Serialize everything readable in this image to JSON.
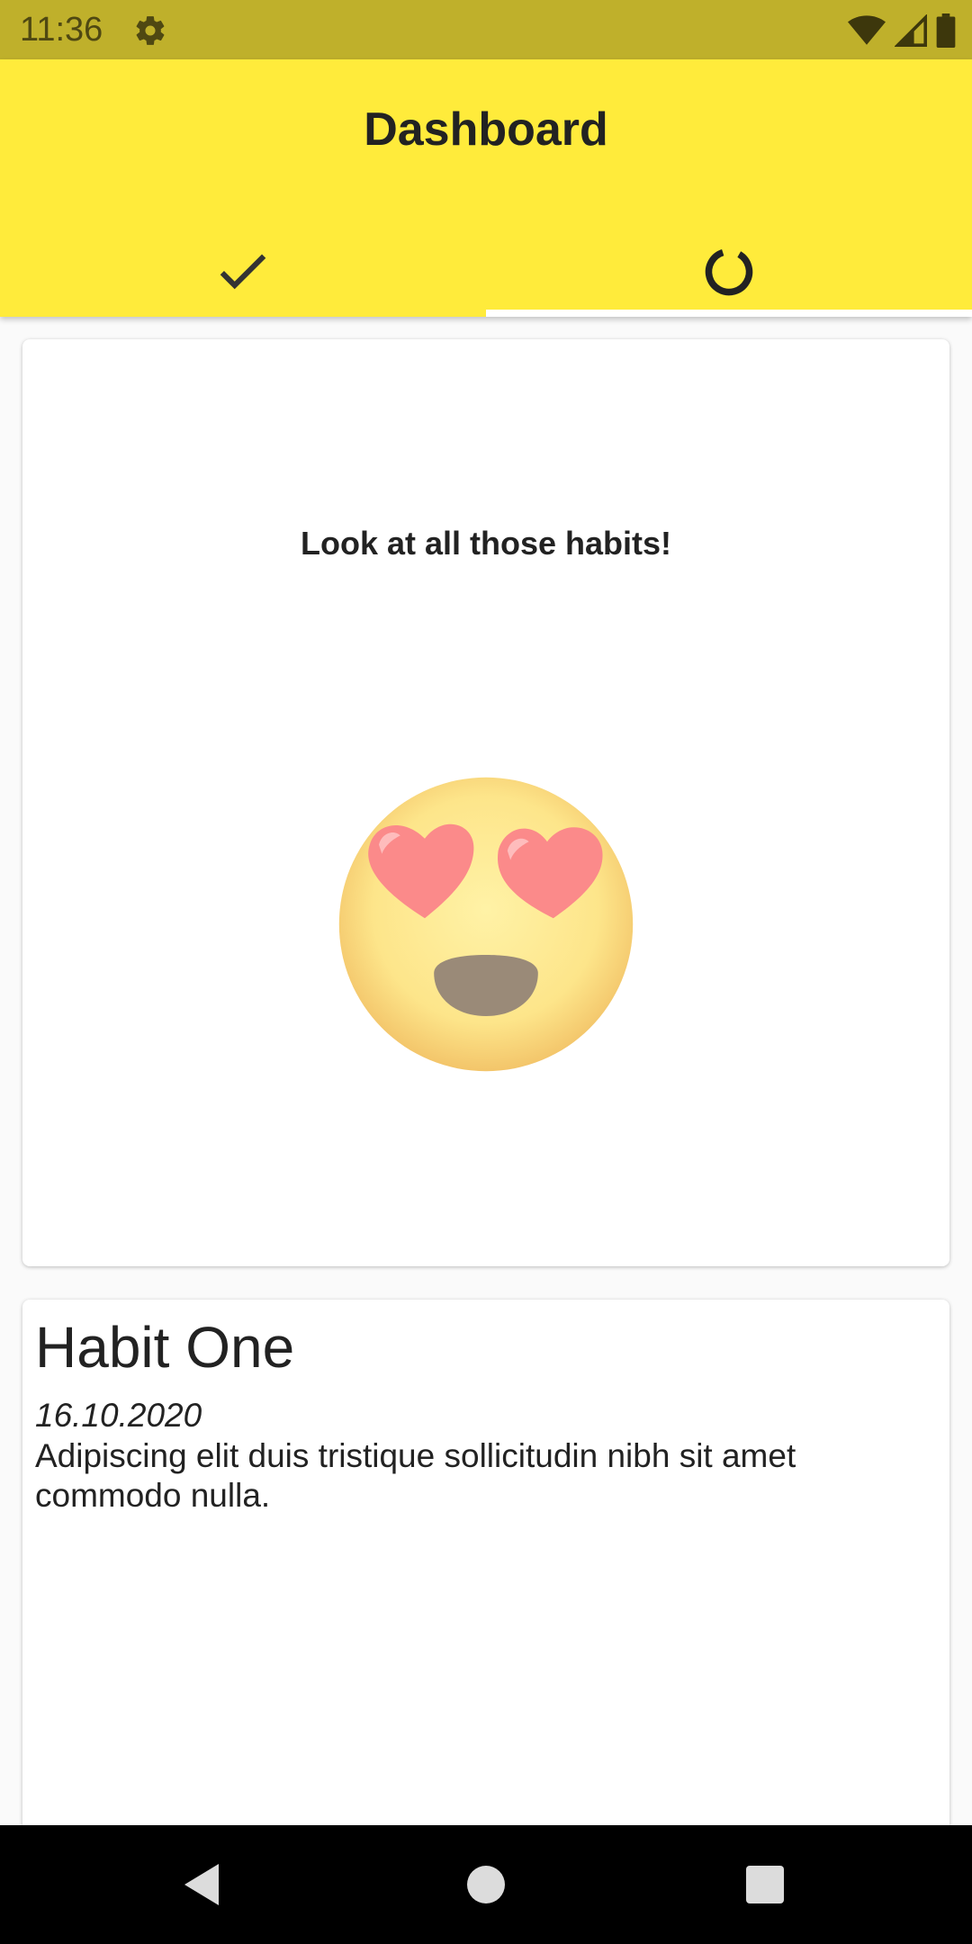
{
  "status_bar": {
    "time": "11:36",
    "icons": [
      "gear-icon",
      "wifi-icon",
      "signal-icon",
      "battery-icon"
    ]
  },
  "app_bar": {
    "title": "Dashboard",
    "tabs": [
      {
        "icon": "check-icon",
        "selected": false
      },
      {
        "icon": "progress-ring-icon",
        "selected": true
      }
    ],
    "color": "#ffeb3b"
  },
  "summary_card": {
    "message": "Look at all those habits!",
    "emoji": "heart-eyes-emoji"
  },
  "habit_card": {
    "title": "Habit One",
    "date": "16.10.2020",
    "description": "Adipiscing elit duis tristique sollicitudin nibh sit amet commodo nulla."
  },
  "nav_bar": {
    "buttons": [
      "back-icon",
      "home-icon",
      "recents-icon"
    ]
  }
}
